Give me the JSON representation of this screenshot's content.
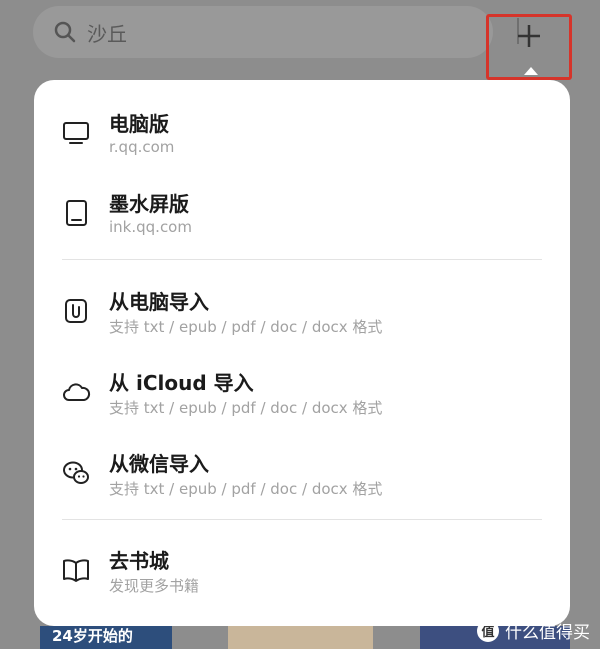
{
  "search": {
    "placeholder": "沙丘"
  },
  "background_books": {
    "book1_text": "24岁开始的"
  },
  "watermark": {
    "logo": "值",
    "text": "什么值得买"
  },
  "menu": {
    "items": [
      {
        "title": "电脑版",
        "subtitle": "r.qq.com",
        "icon": "monitor-icon"
      },
      {
        "title": "墨水屏版",
        "subtitle": "ink.qq.com",
        "icon": "tablet-icon"
      },
      {
        "title": "从电脑导入",
        "subtitle": "支持 txt / epub / pdf / doc / docx 格式",
        "icon": "import-icon"
      },
      {
        "title": "从 iCloud 导入",
        "subtitle": "支持 txt / epub / pdf / doc / docx 格式",
        "icon": "cloud-icon"
      },
      {
        "title": "从微信导入",
        "subtitle": "支持 txt / epub / pdf / doc / docx 格式",
        "icon": "wechat-icon"
      },
      {
        "title": "去书城",
        "subtitle": "发现更多书籍",
        "icon": "book-icon"
      }
    ]
  },
  "colors": {
    "highlight": "#d6342a",
    "overlay": "#8d8d8d",
    "menu_bg": "#ffffff"
  }
}
